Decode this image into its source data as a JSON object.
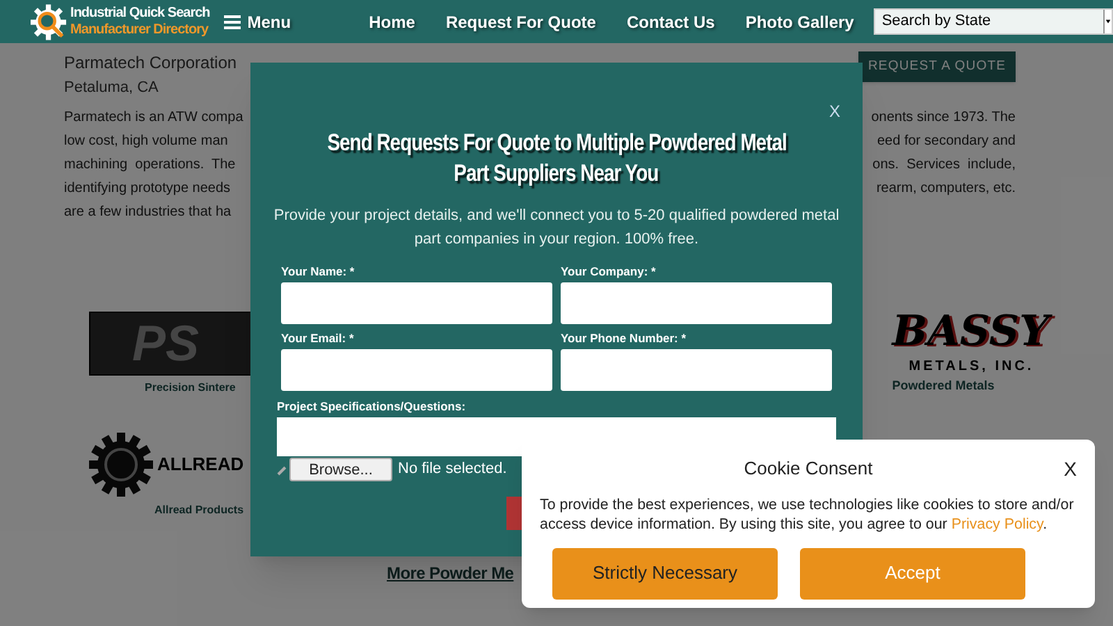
{
  "header": {
    "logo_line1": "Industrial Quick Search",
    "logo_line2": "Manufacturer Directory",
    "menu": "Menu",
    "nav": [
      "Home",
      "Request For Quote",
      "Contact Us",
      "Photo Gallery"
    ],
    "state_select": {
      "value": "Search by State"
    }
  },
  "company": {
    "name": "Parmatech Corporation",
    "location": "Petaluma, CA",
    "quote_button": "REQUEST A QUOTE",
    "paragraph_left": [
      "Parmatech is an ATW compa",
      "low cost, high volume man",
      "machining  operations.  The",
      "identifying prototype needs",
      "are a few industries that ha"
    ],
    "paragraph_right": [
      "onents since 1973. The",
      "eed for secondary and",
      "ons.  Services  include,",
      "rearm, computers, etc."
    ]
  },
  "logos": [
    {
      "kind": "psi",
      "mark": "PS",
      "caption": "Precision Sintere"
    },
    {
      "kind": "bassy",
      "mark": "BASSY",
      "sub": "METALS, INC.",
      "caption": "Powdered Metals"
    },
    {
      "kind": "allread",
      "mark": "ALLREAD",
      "caption": "Allread Products"
    }
  ],
  "more_link": "More Powder Me",
  "modal": {
    "close": "X",
    "title_lines": [
      "Send Requests For Quote to Multiple Powdered Metal",
      "Part Suppliers Near You"
    ],
    "intro_lines": [
      "Provide your project details, and we'll connect you to 5-20 qualified powdered metal",
      "part companies in your region. 100% free."
    ],
    "fields": [
      {
        "label": "Your Name: *"
      },
      {
        "label": "Your Company: *"
      },
      {
        "label": "Your Email: *"
      },
      {
        "label": "Your Phone Number: *"
      }
    ],
    "spec_label": "Project Specifications/Questions:",
    "browse": "Browse...",
    "file_status": "No file selected."
  },
  "cookie": {
    "title": "Cookie Consent",
    "close": "X",
    "text": "To provide the best experiences, we use technologies like cookies to store and/or access device information. By using this site, you agree to our",
    "link": "Privacy Policy",
    "after_link": ".",
    "buttons": [
      {
        "label": "Strictly Necessary",
        "kind": "secondary"
      },
      {
        "label": "Accept",
        "kind": "primary"
      }
    ]
  }
}
